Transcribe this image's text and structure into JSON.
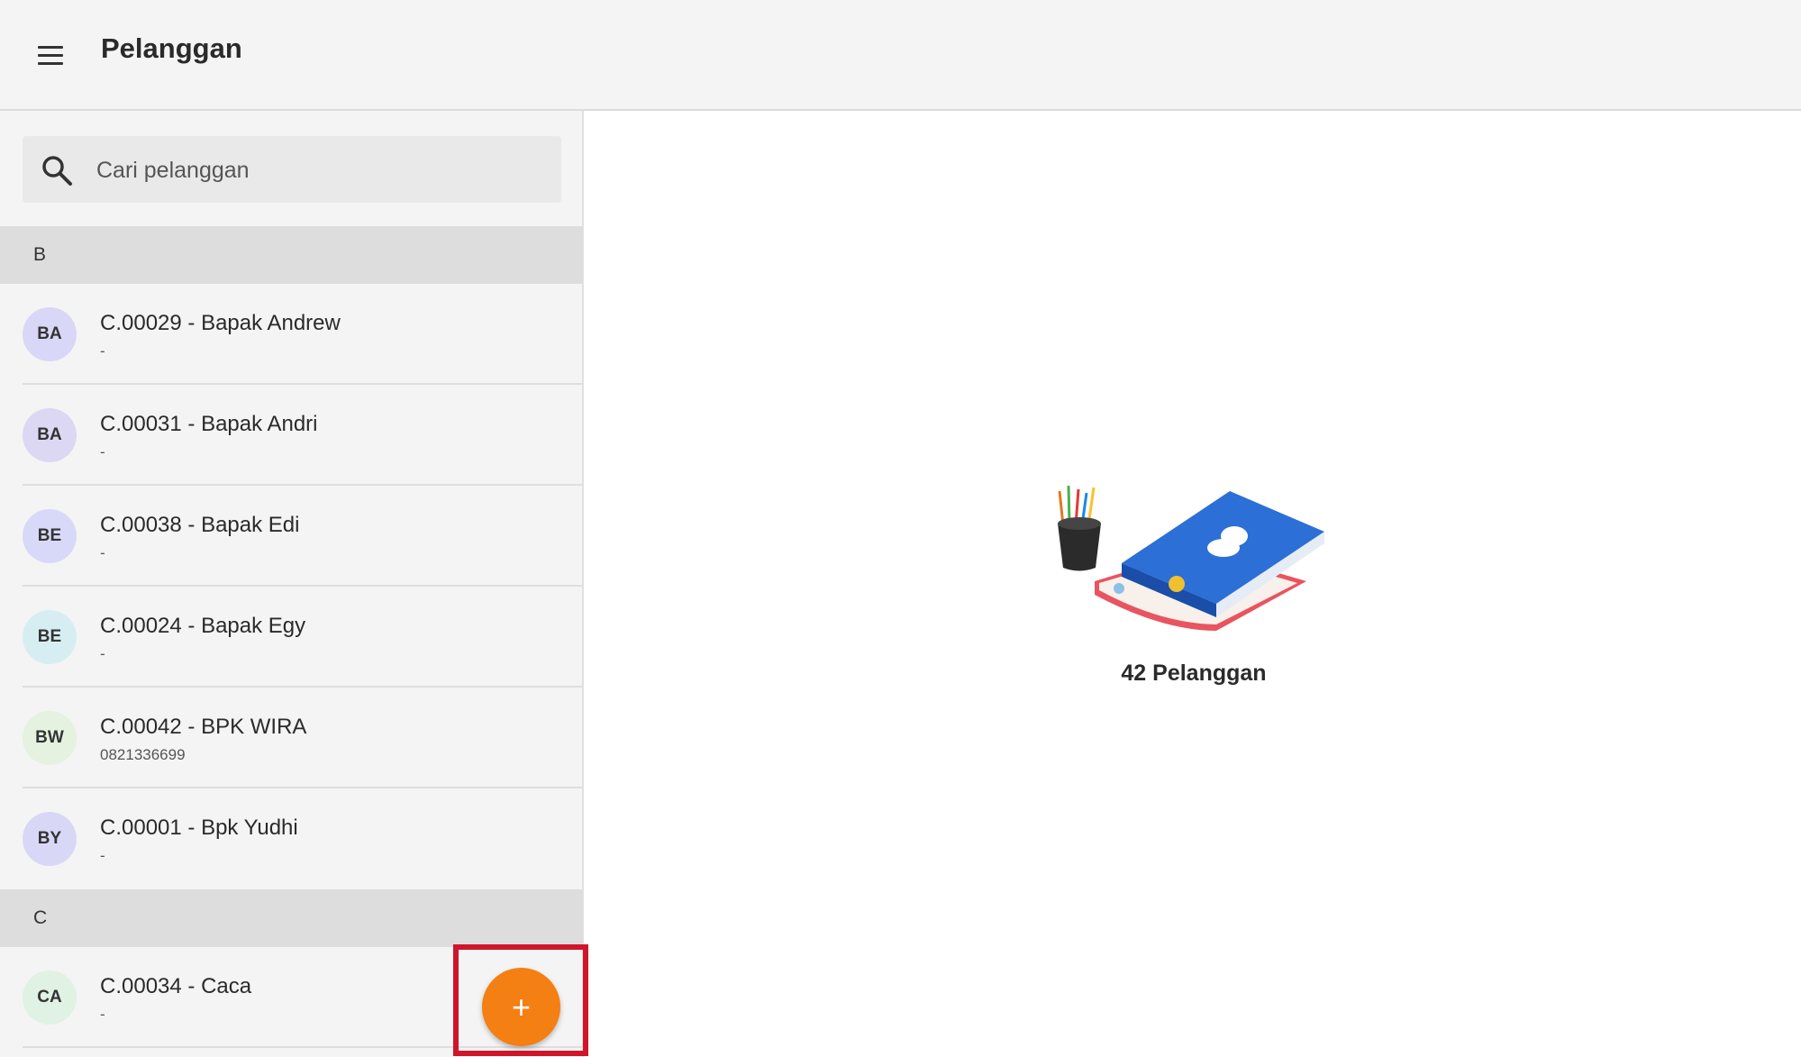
{
  "appbar": {
    "menu_icon": "hamburger-menu-icon",
    "title": "Pelanggan"
  },
  "search": {
    "icon": "search-icon",
    "placeholder": "Cari pelanggan",
    "value": ""
  },
  "sections": [
    {
      "letter": "B",
      "customers": [
        {
          "initials": "BA",
          "name": "C.00029 - Bapak Andrew",
          "phone": "-",
          "avatar_color": "#d9d7f7"
        },
        {
          "initials": "BA",
          "name": "C.00031 - Bapak Andri",
          "phone": "-",
          "avatar_color": "#dcd8f3"
        },
        {
          "initials": "BE",
          "name": "C.00038 - Bapak Edi",
          "phone": "-",
          "avatar_color": "#d8d9f8"
        },
        {
          "initials": "BE",
          "name": "C.00024 - Bapak Egy",
          "phone": "-",
          "avatar_color": "#d6eef2"
        },
        {
          "initials": "BW",
          "name": "C.00042 - BPK WIRA",
          "phone": "0821336699",
          "avatar_color": "#e4f2df"
        },
        {
          "initials": "BY",
          "name": "C.00001 - Bpk Yudhi",
          "phone": "-",
          "avatar_color": "#d8d8f6"
        }
      ]
    },
    {
      "letter": "C",
      "customers": [
        {
          "initials": "CA",
          "name": "C.00034 - Caca",
          "phone": "-",
          "avatar_color": "#dff2e4"
        }
      ]
    }
  ],
  "fab": {
    "icon": "plus-icon",
    "label": "+",
    "color": "#f47f12",
    "highlight_color": "#d0152a"
  },
  "empty_state": {
    "illustration": "address-book-icon",
    "count_label": "42 Pelanggan"
  }
}
